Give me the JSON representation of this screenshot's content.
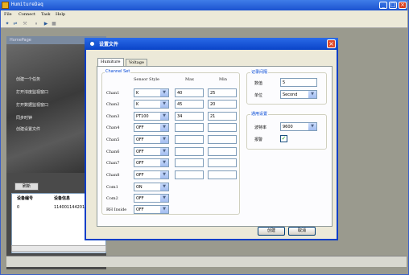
{
  "app": {
    "title": "HumitureDaq"
  },
  "menu": [
    "File",
    "Connect",
    "Task",
    "Help"
  ],
  "left": {
    "header": "HomePage",
    "nav": [
      "创建一个任务",
      "打开浓度监视窗口",
      "打开数据监视窗口",
      "同步时钟",
      "创建设置文件"
    ],
    "refresh_label": "刷新",
    "device_list": {
      "headers": [
        "设备编号",
        "设备信息"
      ],
      "rows": [
        [
          "0",
          "114001144201"
        ]
      ]
    }
  },
  "dialog": {
    "title": "设置文件",
    "tabs": [
      "Humiture",
      "Voltage"
    ],
    "channel_set": {
      "label": "Channel Set",
      "col_sensor": "Sensor Style",
      "col_max": "Max",
      "col_min": "Min",
      "rows": [
        {
          "name": "Chan1",
          "sensor": "K",
          "max": "40",
          "min": "25"
        },
        {
          "name": "Chan2",
          "sensor": "K",
          "max": "45",
          "min": "20"
        },
        {
          "name": "Chan3",
          "sensor": "PT100",
          "max": "34",
          "min": "21"
        },
        {
          "name": "Chan4",
          "sensor": "OFF",
          "max": "",
          "min": ""
        },
        {
          "name": "Chan5",
          "sensor": "OFF",
          "max": "",
          "min": ""
        },
        {
          "name": "Chan6",
          "sensor": "OFF",
          "max": "",
          "min": ""
        },
        {
          "name": "Chan7",
          "sensor": "OFF",
          "max": "",
          "min": ""
        },
        {
          "name": "Chan8",
          "sensor": "OFF",
          "max": "",
          "min": ""
        },
        {
          "name": "Com1",
          "sensor": "ON"
        },
        {
          "name": "Com2",
          "sensor": "OFF"
        },
        {
          "name": "RH Inside",
          "sensor": "OFF"
        }
      ]
    },
    "record_interval": {
      "label": "记录间隔",
      "value_label": "数值",
      "value": "5",
      "unit_label": "单位",
      "unit": "Second"
    },
    "comm": {
      "label": "通用设置",
      "baud_label": "波特率",
      "baud": "9600",
      "alarm_label": "报警",
      "alarm_checked": true
    },
    "buttons": {
      "create": "创建",
      "cancel": "取消"
    }
  }
}
